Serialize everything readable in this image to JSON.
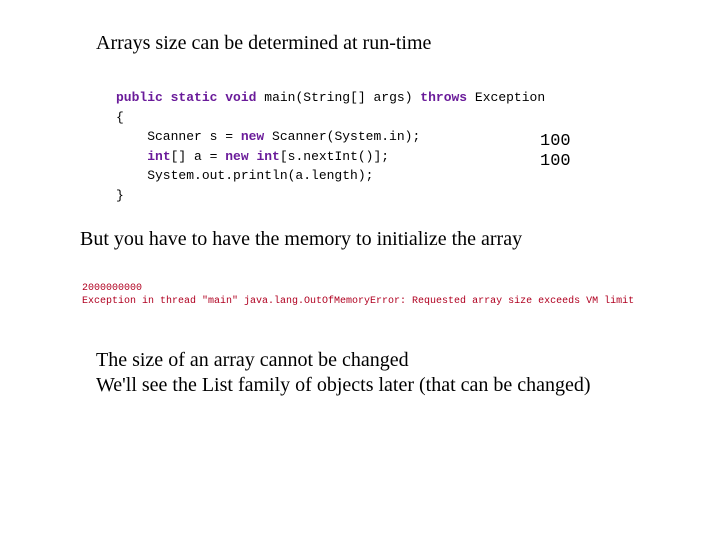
{
  "heading1": "Arrays size can be determined at run-time",
  "code1": {
    "l1_a": "public",
    "l1_b": "static",
    "l1_c": "void",
    "l1_d": " main(String[] args) ",
    "l1_e": "throws",
    "l1_f": " Exception",
    "l2": "{",
    "l3_a": "    Scanner s = ",
    "l3_b": "new",
    "l3_c": " Scanner(System.in);",
    "l4_a": "    ",
    "l4_b": "int",
    "l4_c": "[] a = ",
    "l4_d": "new",
    "l4_e": " ",
    "l4_f": "int",
    "l4_g": "[s.nextInt()];",
    "l5": "    System.out.println(a.length);",
    "l6": "}"
  },
  "output1": {
    "line1": "100",
    "line2": "100"
  },
  "heading2": "But you have to have the memory to initialize the array",
  "error1": {
    "line1": "2000000000",
    "line2": "Exception in thread \"main\" java.lang.OutOfMemoryError: Requested array size exceeds VM limit"
  },
  "para1": {
    "line1": "The size of an array cannot be changed",
    "line2": "We'll see the List family of objects later (that can be changed)"
  }
}
